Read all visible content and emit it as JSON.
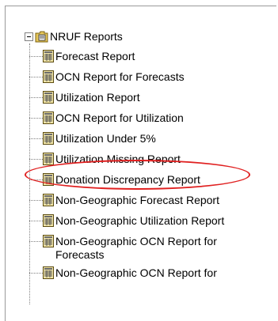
{
  "tree": {
    "root_label": "NRUF Reports",
    "items": [
      {
        "label": "Forecast Report"
      },
      {
        "label": "OCN Report for Forecasts"
      },
      {
        "label": "Utilization Report"
      },
      {
        "label": "OCN Report for Utilization"
      },
      {
        "label": "Utilization Under 5%"
      },
      {
        "label": "Utilization Missing Report"
      },
      {
        "label": "Donation Discrepancy Report"
      },
      {
        "label": "Non-Geographic Forecast Report"
      },
      {
        "label": "Non-Geographic Utilization Report"
      },
      {
        "label": "Non-Geographic OCN Report for",
        "label_line2": "Forecasts"
      },
      {
        "label": "Non-Geographic OCN Report for"
      }
    ]
  },
  "annotation": {
    "highlight_color": "#e02020"
  }
}
